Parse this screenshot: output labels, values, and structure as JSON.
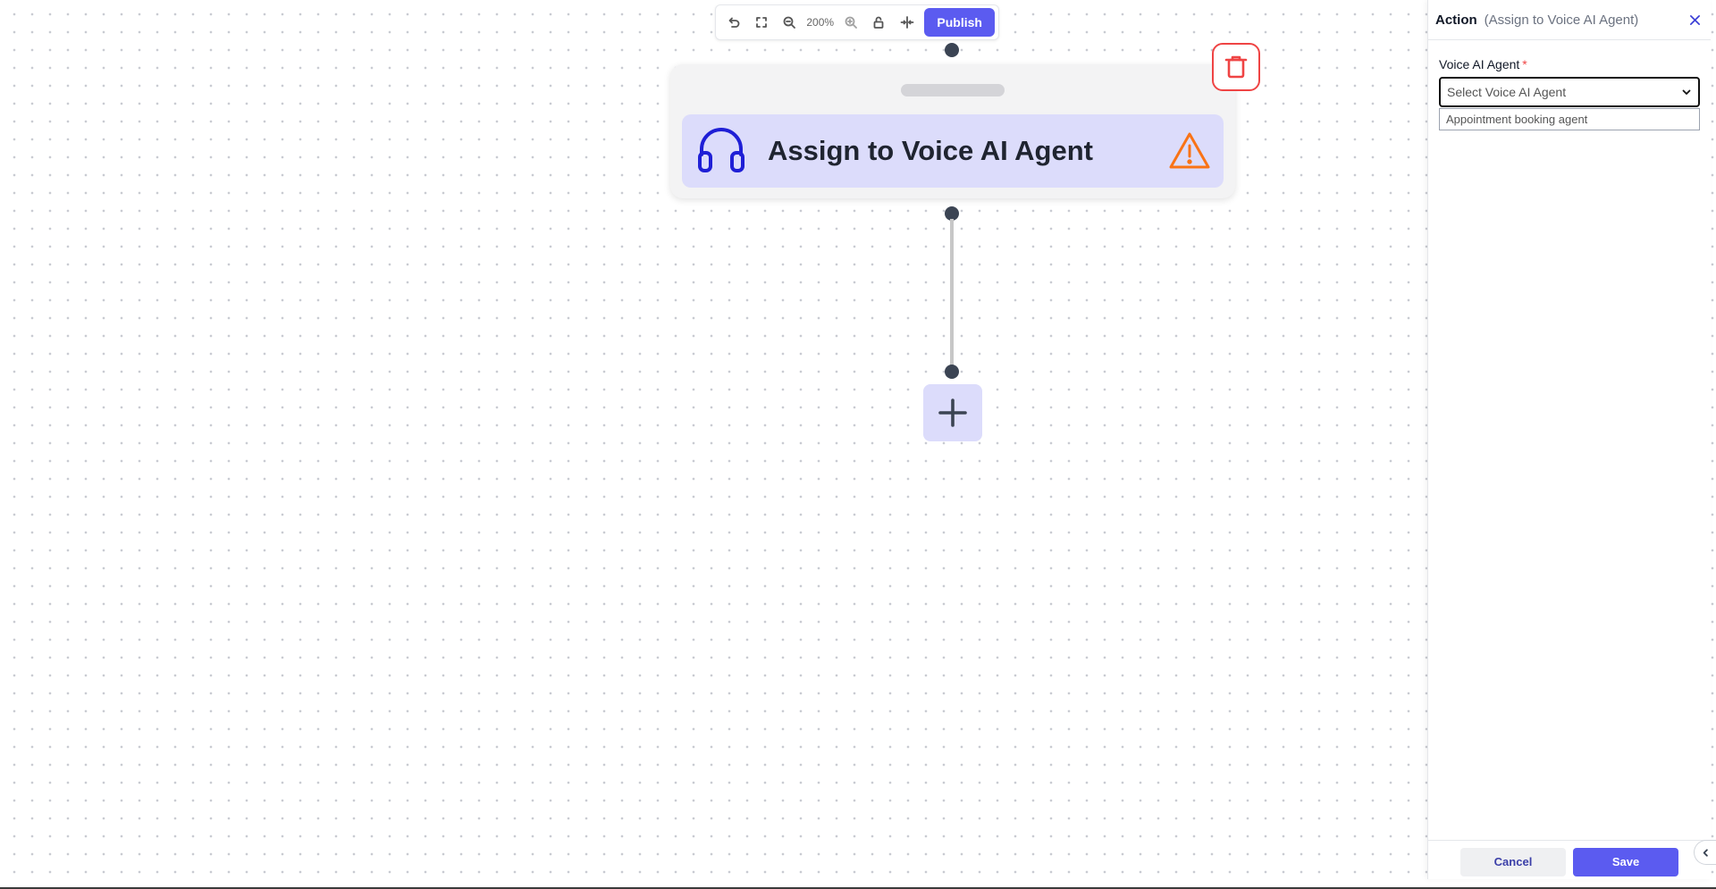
{
  "toolbar": {
    "zoom": "200%",
    "publish_label": "Publish"
  },
  "node": {
    "title": "Assign to Voice AI Agent",
    "icon": "headset-icon",
    "status_icon": "warning-icon"
  },
  "panel": {
    "title": "Action",
    "subtitle": "(Assign to Voice AI Agent)",
    "field_label": "Voice AI Agent",
    "required_mark": "*",
    "select_placeholder": "Select Voice AI Agent",
    "options": [
      "Appointment booking agent"
    ],
    "cancel_label": "Cancel",
    "save_label": "Save"
  },
  "colors": {
    "accent": "#5b5bf0",
    "node_bg": "#dcdcfb",
    "danger": "#ef4444",
    "warning": "#f97316"
  }
}
